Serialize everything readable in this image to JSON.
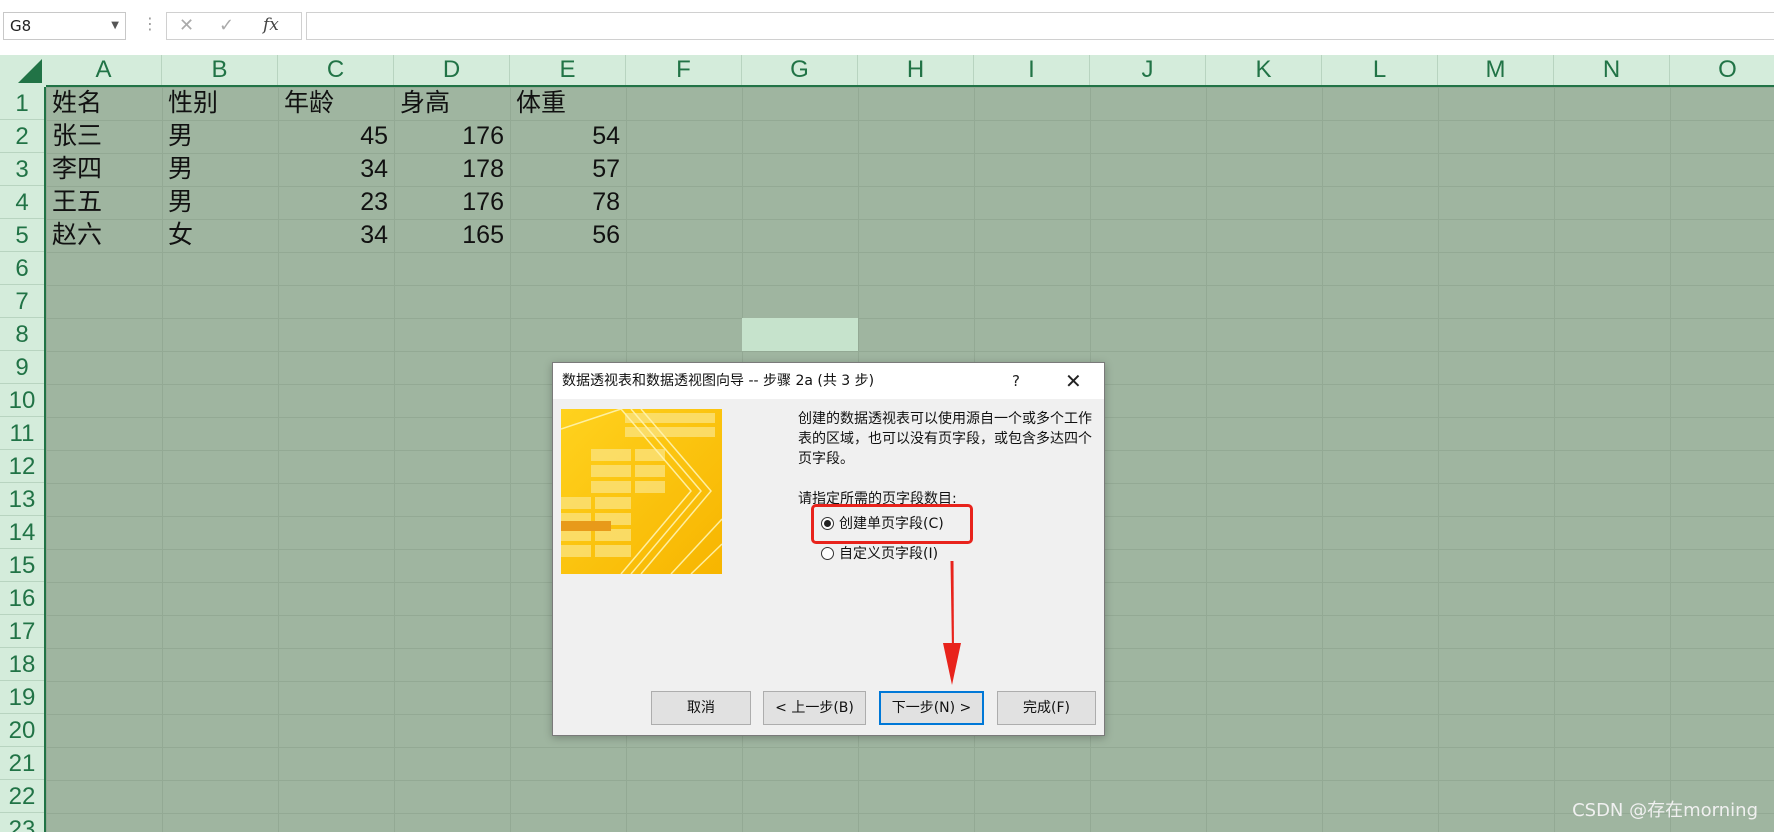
{
  "formula_bar": {
    "name_box": "G8",
    "cancel_glyph": "✕",
    "enter_glyph": "✓",
    "fx_label": "fx",
    "formula": ""
  },
  "columns": [
    "A",
    "B",
    "C",
    "D",
    "E",
    "F",
    "G",
    "H",
    "I",
    "J",
    "K",
    "L",
    "M",
    "N",
    "O"
  ],
  "rows": [
    "1",
    "2",
    "3",
    "4",
    "5",
    "6",
    "7",
    "8",
    "9",
    "10",
    "11",
    "12",
    "13",
    "14",
    "15",
    "16",
    "17",
    "18",
    "19",
    "20",
    "21",
    "22",
    "23"
  ],
  "table": {
    "headers": [
      "姓名",
      "性别",
      "年龄",
      "身高",
      "体重"
    ],
    "records": [
      [
        "张三",
        "男",
        "45",
        "176",
        "54"
      ],
      [
        "李四",
        "男",
        "34",
        "178",
        "57"
      ],
      [
        "王五",
        "男",
        "23",
        "176",
        "78"
      ],
      [
        "赵六",
        "女",
        "34",
        "165",
        "56"
      ]
    ]
  },
  "dialog": {
    "title": "数据透视表和数据透视图向导 -- 步骤 2a (共 3 步)",
    "help": "?",
    "close": "✕",
    "description": "创建的数据透视表可以使用源自一个或多个工作表的区域，也可以没有页字段，或包含多达四个页字段。",
    "prompt": "请指定所需的页字段数目:",
    "options": [
      {
        "label": "创建单页字段(C)",
        "selected": true
      },
      {
        "label": "自定义页字段(I)",
        "selected": false
      }
    ],
    "buttons": {
      "cancel": "取消",
      "back": "< 上一步(B)",
      "next": "下一步(N) >",
      "finish": "完成(F)"
    }
  },
  "annotation_color": "#e8231c",
  "watermark": "CSDN @存在morning"
}
